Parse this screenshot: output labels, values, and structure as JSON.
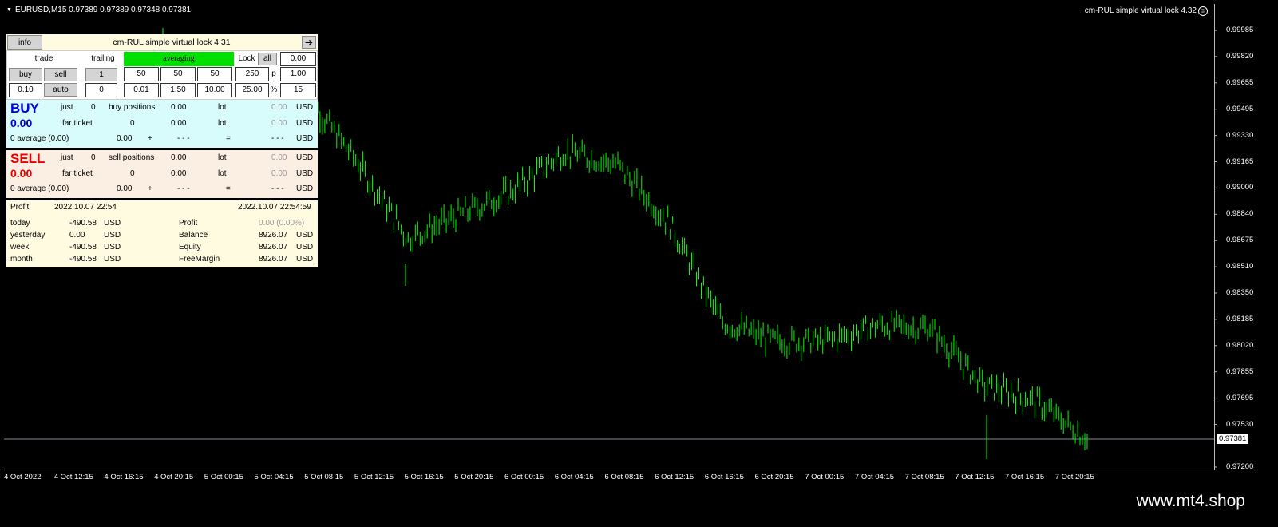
{
  "header": {
    "symbol_info": "EURUSD,M15  0.97389 0.97389 0.97348 0.97381",
    "ea_label": "cm-RUL simple virtual lock 4.32"
  },
  "price_axis": {
    "ticks": [
      "0.99985",
      "0.99820",
      "0.99655",
      "0.99495",
      "0.99330",
      "0.99165",
      "0.99000",
      "0.98840",
      "0.98675",
      "0.98510",
      "0.98350",
      "0.98185",
      "0.98020",
      "0.97855",
      "0.97695",
      "0.97530",
      "0.97200"
    ],
    "current": "0.97381"
  },
  "time_axis": {
    "ticks": [
      "4 Oct 2022",
      "4 Oct 12:15",
      "4 Oct 16:15",
      "4 Oct 20:15",
      "5 Oct 00:15",
      "5 Oct 04:15",
      "5 Oct 08:15",
      "5 Oct 12:15",
      "5 Oct 16:15",
      "5 Oct 20:15",
      "6 Oct 00:15",
      "6 Oct 04:15",
      "6 Oct 08:15",
      "6 Oct 12:15",
      "6 Oct 16:15",
      "6 Oct 20:15",
      "7 Oct 00:15",
      "7 Oct 04:15",
      "7 Oct 08:15",
      "7 Oct 12:15",
      "7 Oct 16:15",
      "7 Oct 20:15"
    ]
  },
  "chart_data": {
    "type": "line",
    "title": "",
    "xlabel": "",
    "ylabel": "",
    "ylim": [
      0.972,
      1.0005
    ],
    "x": [
      "5 Oct 08:15",
      "5 Oct 12:15",
      "5 Oct 16:15",
      "5 Oct 20:15",
      "6 Oct 00:15",
      "6 Oct 04:15",
      "6 Oct 08:15",
      "6 Oct 12:15",
      "6 Oct 16:15",
      "6 Oct 20:15",
      "7 Oct 00:15",
      "7 Oct 04:15",
      "7 Oct 08:15",
      "7 Oct 12:15",
      "7 Oct 16:15",
      "7 Oct 20:15"
    ],
    "series": [
      {
        "values": [
          0.9958,
          0.9915,
          0.9865,
          0.988,
          0.9895,
          0.992,
          0.9912,
          0.9875,
          0.9812,
          0.98,
          0.98,
          0.981,
          0.9808,
          0.9772,
          0.9762,
          0.9738
        ]
      }
    ],
    "color": "#00ff00"
  },
  "panel": {
    "info_label": "info",
    "title": "cm-RUL simple virtual lock 4.31",
    "arrow": "➔",
    "trade_label": "trade",
    "trailing_label": "trailing",
    "averaging_label": "averaging",
    "lock_label": "Lock",
    "all_label": "all",
    "lock_value": "0.00",
    "buy_btn": "buy",
    "sell_btn": "sell",
    "trailing_value": "1",
    "avg1": "50",
    "avg2": "50",
    "avg3": "50",
    "lock_points": "250",
    "p_label": "p",
    "lock_mult": "1.00",
    "lot": "0.10",
    "auto_btn": "auto",
    "trailing_value2": "0",
    "avg4": "0.01",
    "avg5": "1.50",
    "avg6": "10.00",
    "lock_pct": "25.00",
    "pct_label": "%",
    "lock_val2": "15",
    "buy": {
      "label": "BUY",
      "amount": "0.00",
      "just": "just",
      "just_n": "0",
      "positions": "buy positions",
      "pos_val": "0.00",
      "lot": "lot",
      "lot_val": "0.00",
      "usd": "USD",
      "far": "far ticket",
      "far_n": "0",
      "far_val": "0.00",
      "far_lot": "lot",
      "far_lotval": "0.00",
      "far_usd": "USD",
      "avg": "0 average  (0.00)",
      "avg_val": "0.00",
      "plus": "+",
      "dashes": "- - -",
      "eq": "=",
      "dashes2": "- - -",
      "avg_usd": "USD"
    },
    "sell": {
      "label": "SELL",
      "amount": "0.00",
      "just": "just",
      "just_n": "0",
      "positions": "sell positions",
      "pos_val": "0.00",
      "lot": "lot",
      "lot_val": "0.00",
      "usd": "USD",
      "far": "far ticket",
      "far_n": "0",
      "far_val": "0.00",
      "far_lot": "lot",
      "far_lotval": "0.00",
      "far_usd": "USD",
      "avg": "0 average  (0.00)",
      "avg_val": "0.00",
      "plus": "+",
      "dashes": "- - -",
      "eq": "=",
      "dashes2": "- - -",
      "avg_usd": "USD"
    },
    "profit": {
      "label": "Profit",
      "date1": "2022.10.07 22:54",
      "date2": "2022.10.07 22:54:59",
      "rows": [
        {
          "name": "today",
          "val": "-490.58",
          "cur": "USD",
          "name2": "Profit",
          "val2": "0.00  (0.00%)",
          "cur2": ""
        },
        {
          "name": "yesterday",
          "val": "0.00",
          "cur": "USD",
          "name2": "Balance",
          "val2": "8926.07",
          "cur2": "USD"
        },
        {
          "name": "week",
          "val": "-490.58",
          "cur": "USD",
          "name2": "Equity",
          "val2": "8926.07",
          "cur2": "USD"
        },
        {
          "name": "month",
          "val": "-490.58",
          "cur": "USD",
          "name2": "FreeMargin",
          "val2": "8926.07",
          "cur2": "USD"
        }
      ]
    }
  },
  "watermark": "www.mt4.shop"
}
